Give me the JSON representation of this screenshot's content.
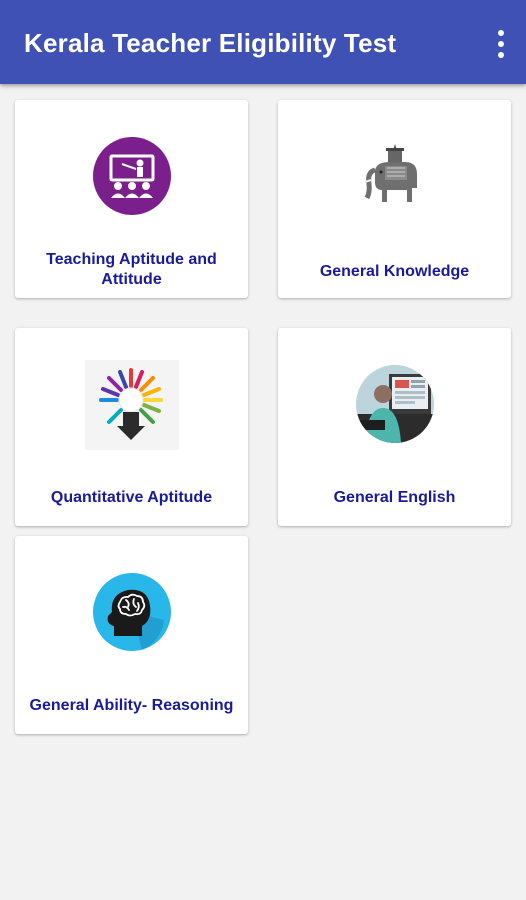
{
  "app_bar": {
    "title": "Kerala Teacher Eligibility Test",
    "color": "#3f51b5",
    "menu_icon": "more-vert-icon"
  },
  "cards": [
    {
      "label": "Teaching  Aptitude and Attitude",
      "icon": "teaching-icon"
    },
    {
      "label": "General Knowledge",
      "icon": "elephant-icon"
    },
    {
      "label": "Quantitative Aptitude",
      "icon": "colorful-head-icon"
    },
    {
      "label": "General English",
      "icon": "computer-user-icon"
    },
    {
      "label": "General Ability- Reasoning",
      "icon": "brain-head-icon"
    }
  ],
  "colors": {
    "label_text": "#1a1a9c",
    "background": "#f2f2f2"
  }
}
